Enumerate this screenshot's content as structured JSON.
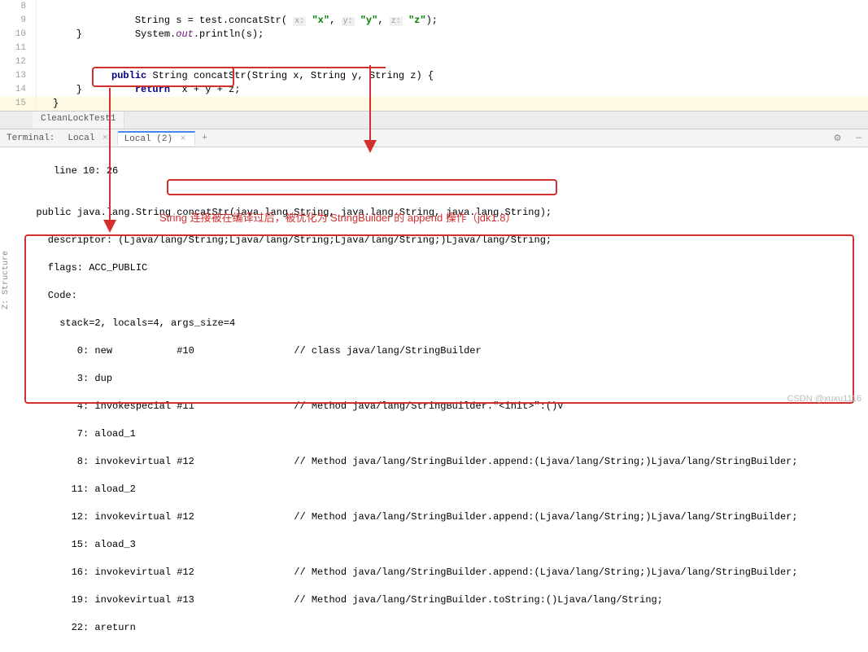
{
  "editor": {
    "lines": [
      {
        "num": "8"
      },
      {
        "num": "9"
      },
      {
        "num": "10"
      },
      {
        "num": "11"
      },
      {
        "num": "12"
      },
      {
        "num": "13"
      },
      {
        "num": "14"
      },
      {
        "num": "15"
      }
    ],
    "l8_pre": "        String s = test.concatStr( ",
    "l8_hint_x": "x:",
    "l8_str_x": "\"x\"",
    "l8_c1": ", ",
    "l8_hint_y": "y:",
    "l8_str_y": "\"y\"",
    "l8_c2": ", ",
    "l8_hint_z": "z:",
    "l8_str_z": "\"z\"",
    "l8_end": ");",
    "l9_pre": "        System.",
    "l9_out": "out",
    "l9_end": ".println(s);",
    "l10": "    }",
    "l11": "",
    "l12_pub": "public",
    "l12_mid": " String ",
    "l12_fn": "concatStr",
    "l12_args": "(String x, String y, String z) {",
    "l13_ret": "return",
    "l13_expr": "  x + y + z;",
    "l14": "    }",
    "l15": "}"
  },
  "tab": {
    "name": "CleanLockTest1"
  },
  "terminal": {
    "label": "Terminal:",
    "tab1": "Local",
    "tab2": "Local (2)",
    "plus": "+",
    "gear": "⚙",
    "hide": "—"
  },
  "output": {
    "line_info": "     line 10: 26",
    "blank1": "",
    "sig_pre": "  public java.lang.String ",
    "sig_fn": "concatStr(java.lang.String, java.lang.String, java.lang.String);",
    "descriptor": "    descriptor: (Ljava/lang/String;Ljava/lang/String;Ljava/lang/String;)Ljava/lang/String;",
    "flags": "    flags: ACC_PUBLIC",
    "code": "    Code:",
    "stack": "      stack=2, locals=4, args_size=4",
    "bc0": "         0: new           #10                 // class java/lang/StringBuilder",
    "bc3": "         3: dup",
    "bc4": "         4: invokespecial #11                 // Method java/lang/StringBuilder.\"<init>\":()V",
    "bc7": "         7: aload_1",
    "bc8": "         8: invokevirtual #12                 // Method java/lang/StringBuilder.append:(Ljava/lang/String;)Ljava/lang/StringBuilder;",
    "bc11": "        11: aload_2",
    "bc12": "        12: invokevirtual #12                 // Method java/lang/StringBuilder.append:(Ljava/lang/String;)Ljava/lang/StringBuilder;",
    "bc15": "        15: aload_3",
    "bc16": "        16: invokevirtual #12                 // Method java/lang/StringBuilder.append:(Ljava/lang/String;)Ljava/lang/StringBuilder;",
    "bc19": "        19: invokevirtual #13                 // Method java/lang/StringBuilder.toString:()Ljava/lang/String;",
    "bc22": "        22: areturn"
  },
  "annotation_text": "String 连接被在编译过后，被优化为 StringBuilder 的 append 操作（jdk1.8）",
  "watermark": "CSDN @xuxu1116",
  "sidebar_label": "Z: Structure"
}
